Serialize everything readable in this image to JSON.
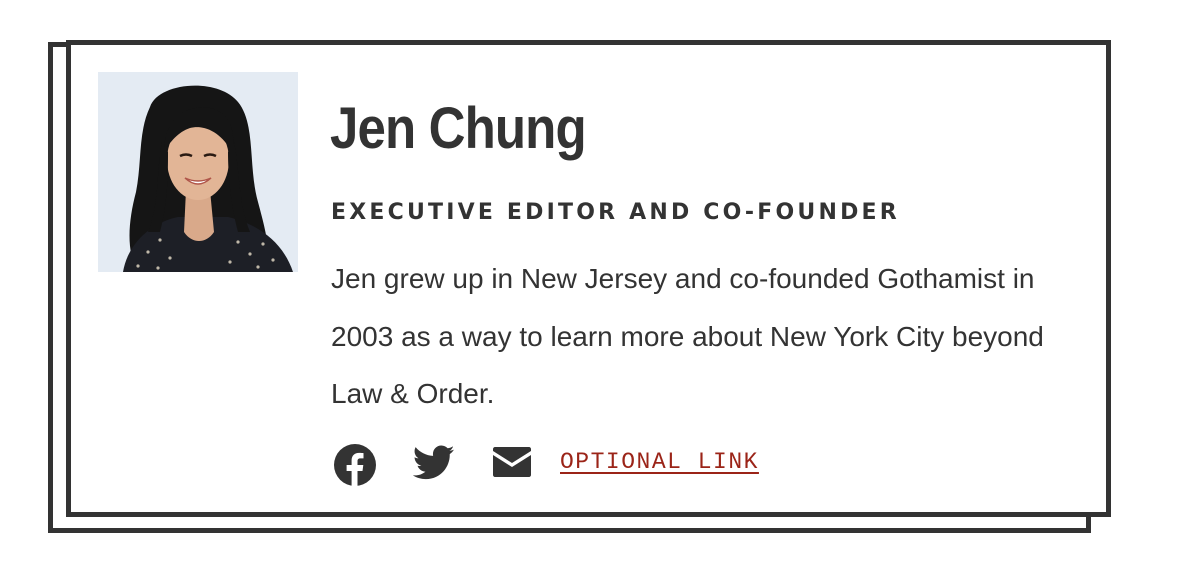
{
  "profile": {
    "name": "Jen Chung",
    "title": "EXECUTIVE EDITOR AND CO-FOUNDER",
    "bio": "Jen grew up in New Jersey and co-founded Gothamist in 2003 as a way to learn more about New York City beyond Law & Order."
  },
  "social": {
    "facebook_icon": "facebook-icon",
    "twitter_icon": "twitter-icon",
    "email_icon": "envelope-icon",
    "link_label": "OPTIONAL LINK"
  },
  "colors": {
    "text": "#333333",
    "border": "#333333",
    "link": "#9b2418",
    "photo_bg": "#e4ebf3"
  }
}
